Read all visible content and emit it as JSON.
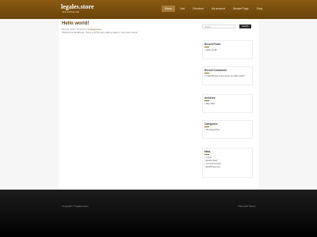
{
  "site": {
    "title": "legales.store",
    "tagline": "Just another site"
  },
  "nav": [
    {
      "label": "Home",
      "active": true
    },
    {
      "label": "Cart",
      "active": false
    },
    {
      "label": "Checkout",
      "active": false
    },
    {
      "label": "My account",
      "active": false
    },
    {
      "label": "Sample Page",
      "active": false
    },
    {
      "label": "Shop",
      "active": false
    }
  ],
  "post": {
    "title": "Hello world!",
    "date": "May 22, 2021",
    "separator": "/",
    "meta_prefix": "Posted in",
    "category": "Uncategorized",
    "excerpt": "Welcome to WordPress. This is your first post. Edit or delete it, then start writing!"
  },
  "search": {
    "placeholder": "Search ...",
    "button_label": "Search"
  },
  "widgets": {
    "recent_posts": {
      "title": "Recent Posts",
      "items": [
        "Hello world!"
      ]
    },
    "recent_comments": {
      "title": "Recent Comments",
      "items": [
        "A WordPress Commenter on Hello world!"
      ]
    },
    "archives": {
      "title": "Archives",
      "items": [
        "May 2021"
      ]
    },
    "categories": {
      "title": "Categories",
      "items": [
        "Uncategorized"
      ]
    },
    "meta": {
      "title": "Meta",
      "items": [
        "Log in",
        "Entries feed",
        "Comments feed",
        "WordPress.org"
      ]
    }
  },
  "footer": {
    "copyright": "Copyright © legales.store",
    "theme_credit": "Themes8 Theme"
  },
  "colors": {
    "header_brown": "#7a4e10",
    "accent": "#a0641a",
    "footer": "#111111"
  }
}
